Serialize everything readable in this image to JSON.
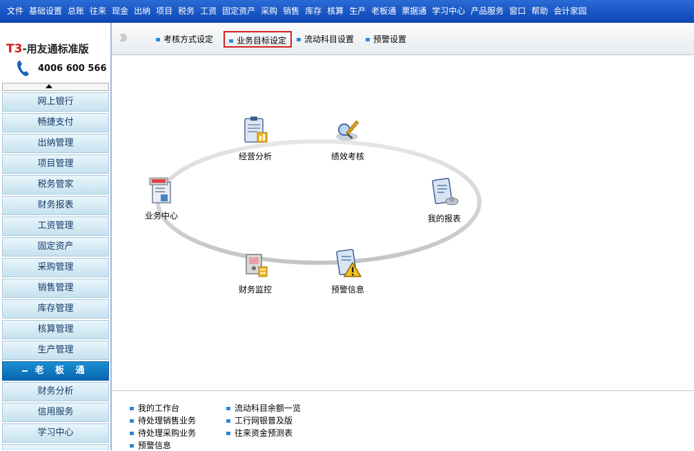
{
  "menu": [
    "文件",
    "基础设置",
    "总账",
    "往来",
    "现金",
    "出纳",
    "项目",
    "税务",
    "工资",
    "固定资产",
    "采购",
    "销售",
    "库存",
    "核算",
    "生产",
    "老板通",
    "票据通",
    "学习中心",
    "产品服务",
    "窗口",
    "帮助",
    "会计家园"
  ],
  "logo": {
    "brand_prefix": "T3",
    "brand_suffix": "-用友通标准版",
    "phone": "4006 600 566"
  },
  "sidebar": {
    "items": [
      "网上银行",
      "畅捷支付",
      "出纳管理",
      "项目管理",
      "税务管家",
      "财务报表",
      "工资管理",
      "固定资产",
      "采购管理",
      "销售管理",
      "库存管理",
      "核算管理",
      "生产管理"
    ],
    "active": "老 板 通",
    "sub_items": [
      "财务分析",
      "信用服务",
      "学习中心"
    ]
  },
  "toolbar": {
    "arrows": "》》",
    "buttons": [
      "考核方式设定",
      "业务目标设定",
      "流动科目设置",
      "预警设置"
    ],
    "selected_index": 1
  },
  "diagram": {
    "nodes": [
      {
        "label": "经营分析",
        "icon": "clipboard-chart-icon"
      },
      {
        "label": "绩效考核",
        "icon": "magnifier-pen-icon"
      },
      {
        "label": "业务中心",
        "icon": "business-center-icon"
      },
      {
        "label": "我的报表",
        "icon": "report-icon"
      },
      {
        "label": "财务监控",
        "icon": "monitor-safe-icon"
      },
      {
        "label": "预警信息",
        "icon": "warning-clipboard-icon"
      }
    ]
  },
  "bottom_links": {
    "col1": [
      "我的工作台",
      "待处理销售业务",
      "待处理采购业务",
      "预警信息"
    ],
    "col2": [
      "流动科目余额一览",
      "工行网银普及版",
      "往来资金预测表"
    ]
  },
  "colors": {
    "menubar": "#0c47b6",
    "selected_border": "#d02020",
    "bullet": "#2f86d8"
  }
}
